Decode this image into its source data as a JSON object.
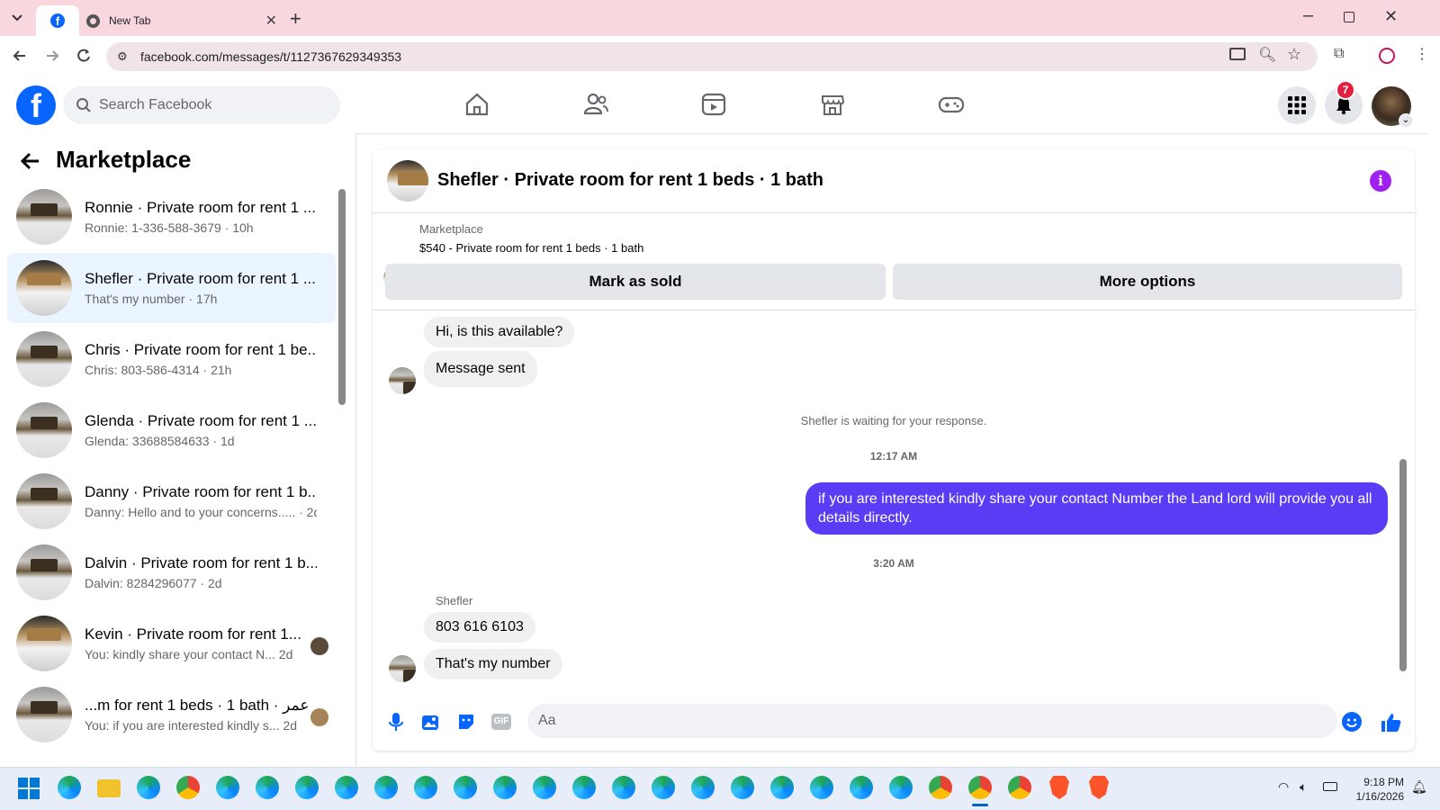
{
  "browser": {
    "active_tab_icon": "facebook-icon",
    "new_tab_title": "New Tab",
    "url": "facebook.com/messages/t/1127367629349353"
  },
  "header": {
    "search_placeholder": "Search Facebook",
    "notification_count": "7"
  },
  "sidebar": {
    "title": "Marketplace",
    "conversations": [
      {
        "name": "Ronnie · Private room for rent 1 ...",
        "preview": "Ronnie: 1-336-588-3679 · 10h",
        "thumb": "light"
      },
      {
        "name": "Shefler · Private room for rent 1 ...",
        "preview": "That's my number · 17h",
        "thumb": "dark"
      },
      {
        "name": "Chris · Private room for rent 1 be...",
        "preview": "Chris: 803-586-4314 · 21h",
        "thumb": "light"
      },
      {
        "name": "Glenda · Private room for rent 1 ...",
        "preview": "Glenda: 33688584633 · 1d",
        "thumb": "light"
      },
      {
        "name": "Danny · Private room for rent 1 b...",
        "preview": "Danny: Hello and to your concerns..... · 2d",
        "thumb": "light"
      },
      {
        "name": "Dalvin · Private room for rent 1 b...",
        "preview": "Dalvin: 8284296077 · 2d",
        "thumb": "light"
      },
      {
        "name": "Kevin · Private room for rent 1...",
        "preview": "You: kindly share your contact N...  2d",
        "thumb": "dark"
      },
      {
        "name": "...m for rent 1 beds · 1 bath · عمر",
        "preview": "You: if you are interested kindly s...  2d",
        "thumb": "light"
      }
    ]
  },
  "chat": {
    "title": "Shefler · Private room for rent 1 beds · 1 bath",
    "listing_label": "Marketplace",
    "listing_text": "$540 - Private room for rent 1 beds · 1 bath",
    "mark_sold": "Mark as sold",
    "more_options": "More options",
    "messages": {
      "m1": "Hi, is this available?",
      "m2": "Message sent",
      "waiting": "Shefler is waiting for your response.",
      "time1": "12:17 AM",
      "outgoing": "if you are interested kindly share your contact Number the Land lord will provide you all details directly.",
      "time2": "3:20 AM",
      "sender": "Shefler",
      "m3": "803 616 6103",
      "m4": "That's my number"
    },
    "composer_placeholder": "Aa"
  },
  "taskbar": {
    "time": "9:18 PM",
    "date": "1/16/2026"
  },
  "colors": {
    "fb_blue": "#0866ff",
    "outgoing_bubble": "#5b3cf5",
    "active_conv": "#ebf5ff",
    "tab_bar": "#f8d7df"
  }
}
